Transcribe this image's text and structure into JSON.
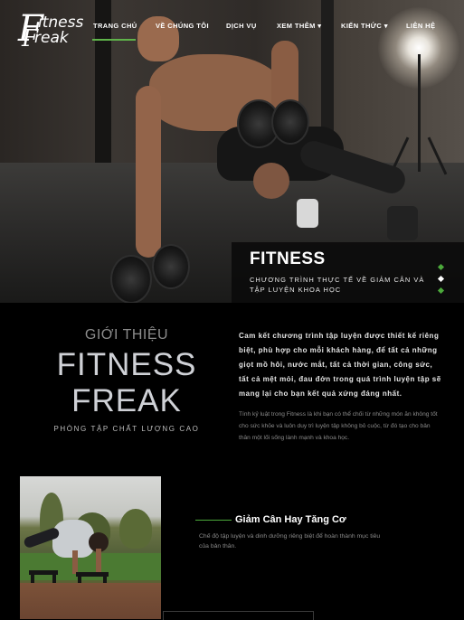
{
  "logo": {
    "line1_big": "F",
    "line1_small": "itness",
    "line2_big": "F",
    "line2_small": "reak"
  },
  "nav": {
    "items": [
      {
        "label": "TRANG CHỦ"
      },
      {
        "label": "VỀ CHÚNG TÔI"
      },
      {
        "label": "DỊCH VỤ"
      },
      {
        "label": "XEM THÊM",
        "caret": "▾"
      },
      {
        "label": "KIẾN THỨC",
        "caret": "▾"
      },
      {
        "label": "LIÊN HỆ"
      }
    ],
    "active_index": 0,
    "accent_color": "#5fb34a"
  },
  "hero": {
    "caption_title": "FITNESS",
    "caption_subtitle": "CHƯƠNG TRÌNH THỰC TẾ VỀ GIẢM CÂN VÀ TẬP LUYỆN KHOA HỌC",
    "slides": 3,
    "active_slide": 1
  },
  "intro": {
    "kicker": "GIỚI THIỆU",
    "title_line1": "FITNESS",
    "title_line2": "FREAK",
    "tagline": "PHÒNG TẬP CHẤT LƯỢNG CAO",
    "paragraph1": "Cam kết chương trình tập luyện được thiết kế riêng biệt, phù hợp cho mỗi khách hàng, để tất cả những giọt mồ hôi, nước mắt, tất cả thời gian, công sức, tất cả mệt mỏi, đau đớn trong quá trình luyện tập sẽ mang lại cho bạn kết quả xứng đáng nhất.",
    "paragraph2": "Tính kỷ luật trong Fitness là khi bạn có thể chối từ những món ăn không tốt cho sức khỏe và luôn duy trì luyện tập không bỏ cuộc, từ đó tạo cho bản thân một lối sống lành mạnh và khoa học."
  },
  "feature": {
    "title": "Giảm Cân Hay Tăng Cơ",
    "description": "Chế độ tập luyện và dinh dưỡng riêng biệt để hoàn thành mục tiêu của bản thân."
  }
}
